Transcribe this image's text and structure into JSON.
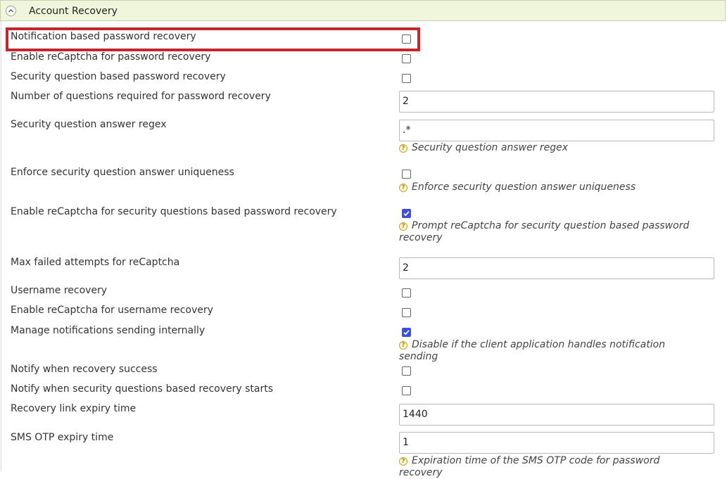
{
  "header": {
    "title": "Account Recovery"
  },
  "rows": [
    {
      "label": "Notification based password recovery",
      "checked": false
    },
    {
      "label": "Enable reCaptcha for password recovery",
      "checked": false
    },
    {
      "label": "Security question based password recovery",
      "checked": false
    },
    {
      "label": "Number of questions required for password recovery",
      "value": "2"
    },
    {
      "label": "Security question answer regex",
      "value": ".*",
      "help": "Security question answer regex"
    },
    {
      "label": "Enforce security question answer uniqueness",
      "checked": false,
      "help": "Enforce security question answer uniqueness"
    },
    {
      "label": "Enable reCaptcha for security questions based password recovery",
      "checked": true,
      "help": "Prompt reCaptcha for security question based password recovery"
    },
    {
      "label": "Max failed attempts for reCaptcha",
      "value": "2"
    },
    {
      "label": "Username recovery",
      "checked": false
    },
    {
      "label": "Enable reCaptcha for username recovery",
      "checked": false
    },
    {
      "label": "Manage notifications sending internally",
      "checked": true,
      "help": "Disable if the client application handles notification sending"
    },
    {
      "label": "Notify when recovery success",
      "checked": false
    },
    {
      "label": "Notify when security questions based recovery starts",
      "checked": false
    },
    {
      "label": "Recovery link expiry time",
      "value": "1440"
    },
    {
      "label": "SMS OTP expiry time",
      "value": "1",
      "help": "Expiration time of the SMS OTP code for password recovery"
    }
  ],
  "icons": {
    "collapse": "chevron-up-icon",
    "help": "help-icon"
  },
  "colors": {
    "highlight": "#c1272d",
    "checked": "#3b4ee0",
    "header_bg": "#f0f6dc"
  }
}
